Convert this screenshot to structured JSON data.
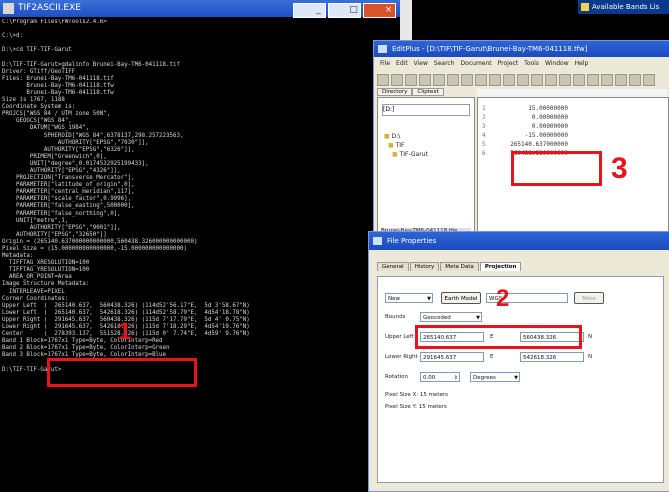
{
  "console": {
    "title": "TIF2ASCII.EXE",
    "lines": [
      "C:\\Program Files\\FWTools2.4.6>",
      "",
      "C:\\>d:",
      "",
      "D:\\>cd TIF-TIF-Garut",
      "",
      "D:\\TIF-TIF-Garut>gdalinfo Brunei-Bay-TM6-041118.tif",
      "Driver: GTiff/GeoTIFF",
      "Files: Brunei-Bay-TM6-041118.tif",
      "       Brunei-Bay-TM6-041118.tfw",
      "       Brunei-Bay-TM6-041118.tfw",
      "Size is 1767, 1188",
      "Coordinate System is:",
      "PROJCS[\"WGS 84 / UTM zone 50N\",",
      "    GEOGCS[\"WGS 84\",",
      "        DATUM[\"WGS_1984\",",
      "            SPHEROID[\"WGS 84\",6378137,298.257223563,",
      "                AUTHORITY[\"EPSG\",\"7030\"]],",
      "            AUTHORITY[\"EPSG\",\"6326\"]],",
      "        PRIMEM[\"Greenwich\",0],",
      "        UNIT[\"degree\",0.0174532925199433],",
      "        AUTHORITY[\"EPSG\",\"4326\"]],",
      "    PROJECTION[\"Transverse_Mercator\"],",
      "    PARAMETER[\"latitude_of_origin\",0],",
      "    PARAMETER[\"central_meridian\",117],",
      "    PARAMETER[\"scale_factor\",0.9996],",
      "    PARAMETER[\"false_easting\",500000],",
      "    PARAMETER[\"false_northing\",0],",
      "    UNIT[\"metre\",1,",
      "        AUTHORITY[\"EPSG\",\"9001\"]],",
      "    AUTHORITY[\"EPSG\",\"32650\"]]",
      "Origin = (265140.637000000000000,560438.326000000000000)",
      "Pixel Size = (15.000000000000000,-15.000000000000000)",
      "Metadata:",
      "  TIFFTAG_XRESOLUTION=100",
      "  TIFFTAG_YRESOLUTION=100",
      "  AREA_OR_POINT=Area",
      "Image Structure Metadata:",
      "  INTERLEAVE=PIXEL",
      "Corner Coordinates:",
      "Upper Left  (  265140.637,  560438.326) (114d52'56.17\"E,  5d 3'58.67\"N)",
      "Lower Left  (  265140.637,  542618.326) (114d52'58.79\"E,  4d54'18.78\"N)",
      "Upper Right (  291645.637,  560438.326) (115d 7'17.79\"E,  5d 4' 0.75\"N)",
      "Lower Right (  291645.637,  542618.326) (115d 7'18.29\"E,  4d54'19.76\"N)",
      "Center      (  278393.137,  551528.326) (115d 0' 7.74\"E,  4d59' 9.76\"N)",
      "Band 1 Block=1767x1 Type=Byte, ColorInterp=Red",
      "Band 2 Block=1767x1 Type=Byte, ColorInterp=Green",
      "Band 3 Block=1767x1 Type=Byte, ColorInterp=Blue",
      "",
      "D:\\TIF-TIF-Garut>"
    ]
  },
  "available_bands": {
    "title": "Available Bands Lis"
  },
  "editplus": {
    "title": "EditPlus - [D:\\TIF\\TIF-Garut\\Brunei-Bay-TM6-041118.tfw]",
    "menu": [
      "File",
      "Edit",
      "View",
      "Search",
      "Document",
      "Project",
      "Tools",
      "Window",
      "Help"
    ],
    "tabs": [
      "Directory",
      "Cliptext"
    ],
    "drive": "[D:]",
    "tree": [
      "D:\\",
      "TIF",
      "TIF-Garut"
    ],
    "file_label": "Brunei-Bay-TM6-041118.tfw",
    "line_numbers": [
      "1",
      "2",
      "3",
      "4",
      "5",
      "6"
    ],
    "values": [
      "15.00000000",
      "0.00000000",
      "0.00000000",
      "-15.00000000",
      "265140.637000000",
      "560438.326000000"
    ]
  },
  "file_properties": {
    "title": "File Properties",
    "tabs": [
      "General",
      "History",
      "Meta Data",
      "Projection"
    ],
    "active_tab": "Projection",
    "projection_select": "New",
    "earth_model_button": "Earth Model",
    "datum_field": "WGS",
    "more_button": "More",
    "bounds_label": "Bounds",
    "bounds_value": "Geocoded",
    "upper_left_label": "Upper Left",
    "upper_left_x": "265140.637",
    "upper_left_e": "E",
    "upper_left_y": "560438.326",
    "upper_left_n": "N",
    "lower_right_label": "Lower Right",
    "lower_right_x": "291645.637",
    "lower_right_e": "E",
    "lower_right_y": "542618.326",
    "lower_right_n": "N",
    "rotation_label": "Rotation",
    "rotation_value": "0.00",
    "rotation_unit": "Degrees",
    "pixel_size_x": "Pixel Size X: 15 meters",
    "pixel_size_y": "Pixel Size Y: 15 meters"
  },
  "annotations": {
    "one": "1",
    "two": "2",
    "three": "3",
    "color": "#e8141d"
  }
}
